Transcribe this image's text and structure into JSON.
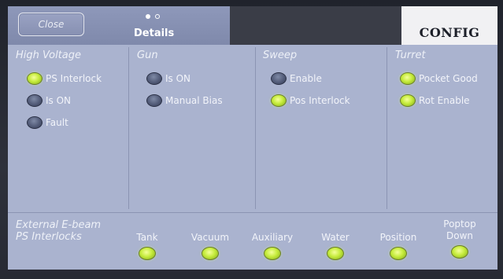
{
  "header": {
    "close_label": "Close",
    "details_label": "Details",
    "config_label": "CONFIG"
  },
  "columns": [
    {
      "title": "High Voltage",
      "indicators": [
        {
          "label": "PS Interlock",
          "state": "green"
        },
        {
          "label": "Is ON",
          "state": "off"
        },
        {
          "label": "Fault",
          "state": "off"
        }
      ]
    },
    {
      "title": "Gun",
      "indicators": [
        {
          "label": "Is ON",
          "state": "off"
        },
        {
          "label": "Manual Bias",
          "state": "off"
        }
      ]
    },
    {
      "title": "Sweep",
      "indicators": [
        {
          "label": "Enable",
          "state": "off"
        },
        {
          "label": "Pos Interlock",
          "state": "green"
        }
      ]
    },
    {
      "title": "Turret",
      "indicators": [
        {
          "label": "Pocket Good",
          "state": "green"
        },
        {
          "label": "Rot Enable",
          "state": "green"
        }
      ]
    }
  ],
  "external": {
    "title_line1": "External E-beam",
    "title_line2": "PS Interlocks",
    "items": [
      {
        "label": "Tank",
        "state": "green"
      },
      {
        "label": "Vacuum",
        "state": "green"
      },
      {
        "label": "Auxiliary",
        "state": "green"
      },
      {
        "label": "Water",
        "state": "green"
      },
      {
        "label": "Position",
        "state": "green"
      },
      {
        "label_line1": "Poptop",
        "label_line2": "Down",
        "state": "green"
      }
    ]
  },
  "colors": {
    "panel": "#aab3cf",
    "led_on": "#c6ec3c",
    "led_off": "#525b78",
    "config_tab": "#f1f1f3"
  }
}
